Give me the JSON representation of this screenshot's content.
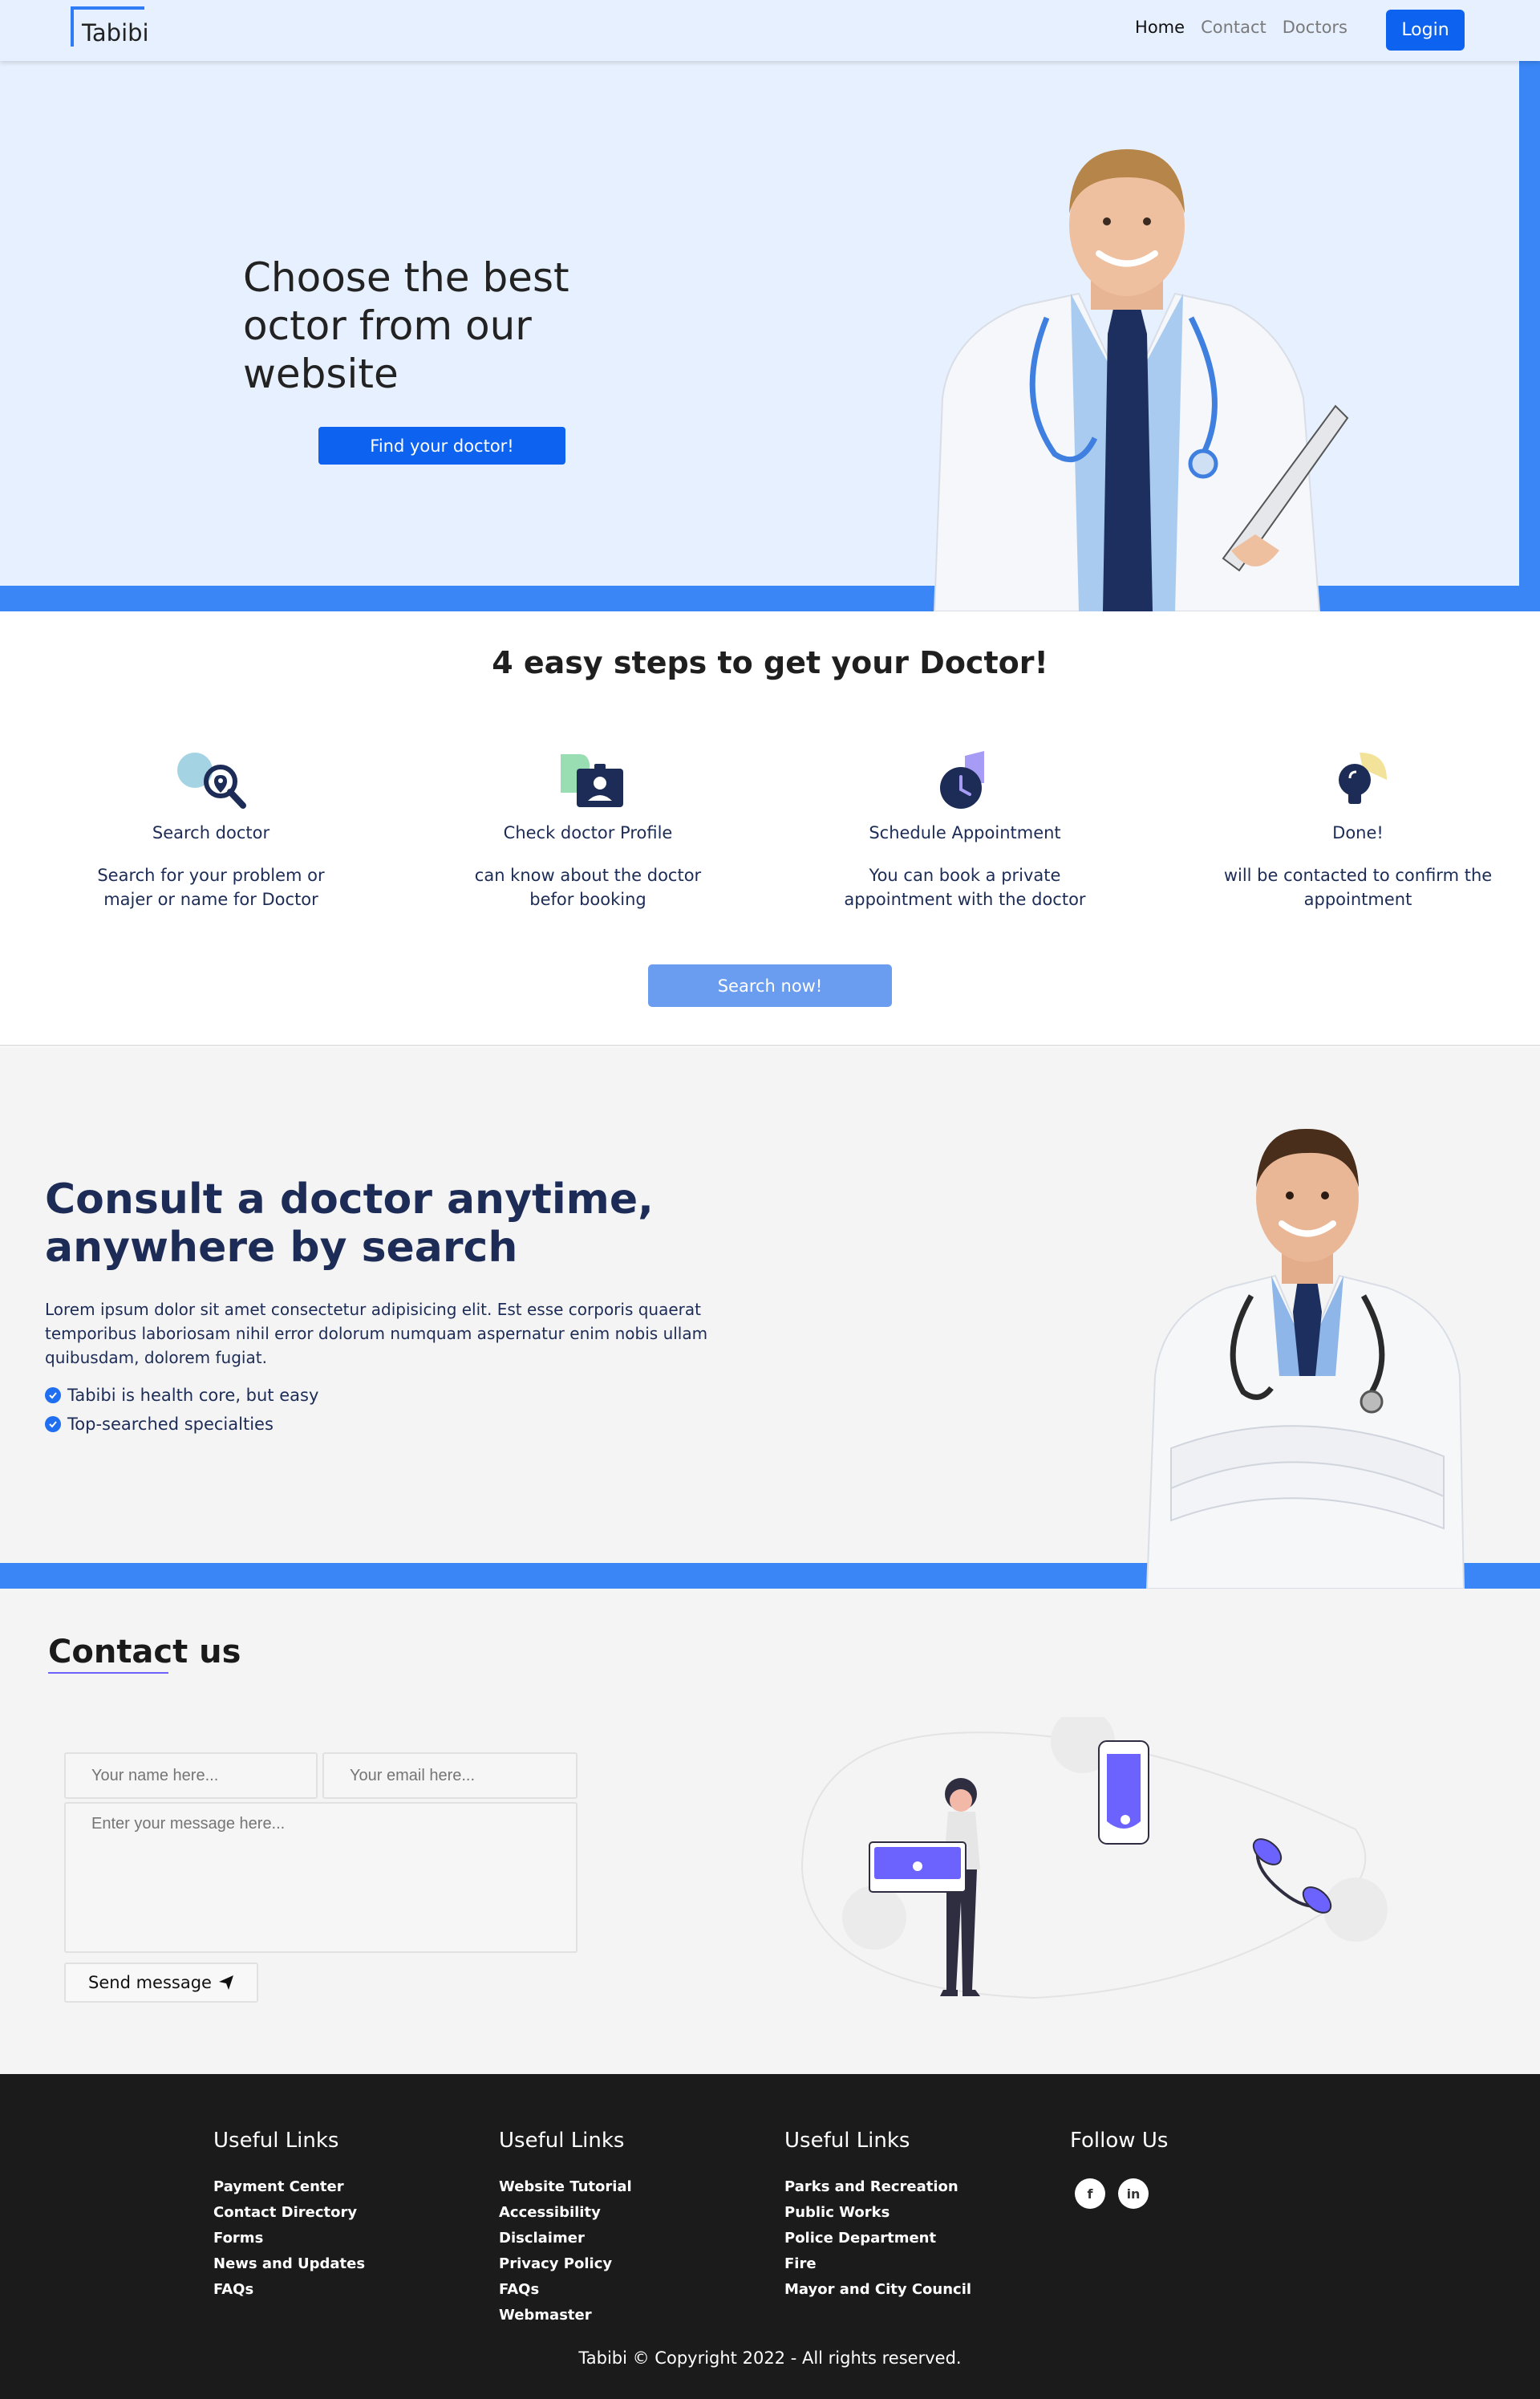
{
  "nav": {
    "brand": "Tabibi",
    "links": [
      "Home",
      "Contact",
      "Doctors"
    ],
    "login": "Login"
  },
  "hero": {
    "title": "Choose the best octor from our website",
    "cta": "Find your doctor!"
  },
  "steps": {
    "title": "4 easy steps to get your Doctor!",
    "items": [
      {
        "icon": "search-doctor-icon",
        "title": "Search doctor",
        "desc": "Search for your problem or majer or name for Doctor"
      },
      {
        "icon": "id-card-icon",
        "title": "Check doctor Profile",
        "desc": "can know about the doctor befor booking"
      },
      {
        "icon": "clock-icon",
        "title": "Schedule Appointment",
        "desc": "You can book a private appointment with the doctor"
      },
      {
        "icon": "lightbulb-icon",
        "title": "Done!",
        "desc": "will be contacted to confirm the appointment"
      }
    ],
    "cta": "Search now!"
  },
  "consult": {
    "title": "Consult a doctor anytime, anywhere by search",
    "text": "Lorem ipsum dolor sit amet consectetur adipisicing elit. Est esse corporis quaerat temporibus laboriosam nihil error dolorum numquam aspernatur enim nobis ullam quibusdam, dolorem fugiat.",
    "bullets": [
      "Tabibi is health core, but easy",
      "Top-searched specialties"
    ]
  },
  "contact": {
    "title": "Contact us",
    "name_placeholder": "Your name here...",
    "email_placeholder": "Your email here...",
    "message_placeholder": "Enter your message here...",
    "send": "Send message"
  },
  "footer": {
    "col1": {
      "title": "Useful Links",
      "links": [
        "Payment Center",
        "Contact Directory",
        "Forms",
        "News and Updates",
        "FAQs"
      ]
    },
    "col2": {
      "title": "Useful Links",
      "links": [
        "Website Tutorial",
        "Accessibility",
        "Disclaimer",
        "Privacy Policy",
        "FAQs",
        "Webmaster"
      ]
    },
    "col3": {
      "title": "Useful Links",
      "links": [
        "Parks and Recreation",
        "Public Works",
        "Police Department",
        "Fire",
        "Mayor and City Council"
      ]
    },
    "follow": "Follow Us",
    "social": [
      "f",
      "in"
    ],
    "copyright": "Tabibi © Copyright 2022 - All rights reserved."
  },
  "colors": {
    "primary": "#0d62f0",
    "accent": "#3a86f6",
    "hero_bg": "#e7f0fe",
    "navy": "#1d2c56",
    "footer_bg": "#1b1b1c"
  }
}
